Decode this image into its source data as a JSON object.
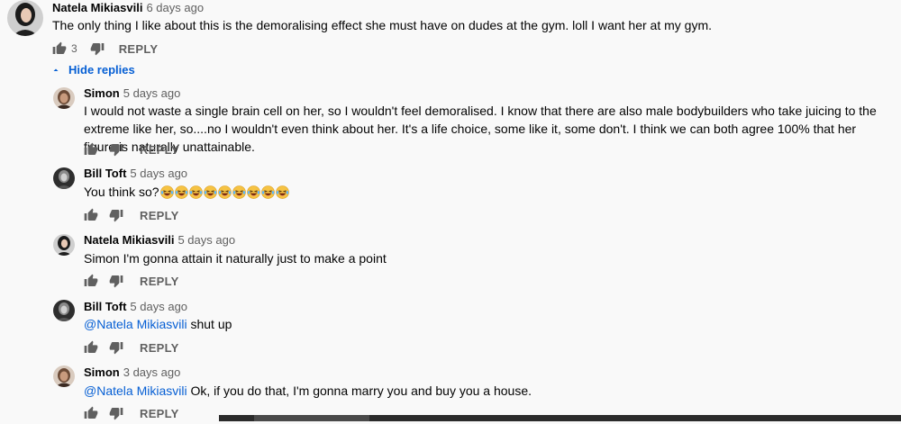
{
  "comment": {
    "author": "Natela Mikiasvili",
    "time": "6 days ago",
    "text": "The only thing I like about this is the demoralising effect she must have on dudes at the gym. loll I want her at my gym.",
    "like_count": "3",
    "reply_label": "REPLY"
  },
  "hide_replies_label": "Hide replies",
  "replies": [
    {
      "author": "Simon",
      "time": "5 days ago",
      "text": "I would not waste a single brain cell on her, so I wouldn't feel demoralised. I know that there are also male bodybuilders who take juicing to the extreme like her, so....no I wouldn't even think about her. It's a life choice, some like it, some don't. I think we can both agree 100% that her figure is naturally unattainable.",
      "reply_label": "REPLY"
    },
    {
      "author": "Bill Toft",
      "time": "5 days ago",
      "text": "You think so?",
      "emoji_icon": "laughing-emoji-icon",
      "reply_label": "REPLY"
    },
    {
      "author": "Natela Mikiasvili",
      "time": "5 days ago",
      "text": "Simon I'm gonna attain it naturally just to make a point",
      "reply_label": "REPLY"
    },
    {
      "author": "Bill Toft",
      "time": "5 days ago",
      "mention": "@Natela Mikiasvili",
      "text": " shut up",
      "reply_label": "REPLY"
    },
    {
      "author": "Simon",
      "time": "3 days ago",
      "mention": "@Natela Mikiasvili",
      "text": " Ok, if you do that, I'm gonna marry you and buy you a house.",
      "reply_label": "REPLY"
    }
  ],
  "colors": {
    "background": "#f9f9f9",
    "link": "#065fd4",
    "secondary_text": "#606060"
  }
}
